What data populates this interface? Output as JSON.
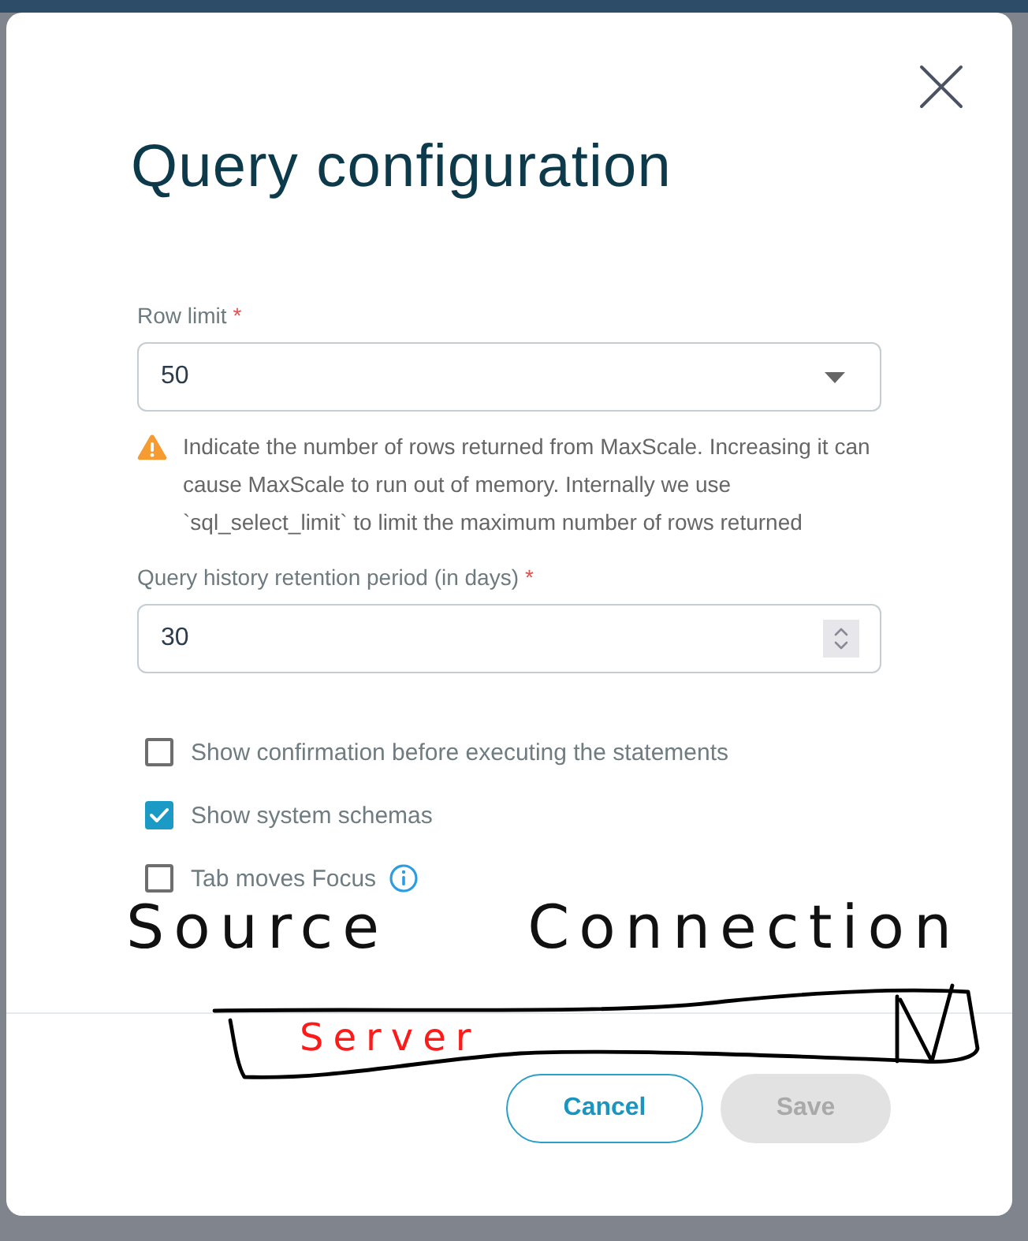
{
  "dialog": {
    "title": "Query configuration"
  },
  "row_limit": {
    "label": "Row limit",
    "required_mark": "*",
    "value": "50",
    "warning": "Indicate the number of rows returned from MaxScale. Increasing it can cause MaxScale to run out of memory. Internally we use `sql_select_limit` to limit the maximum number of rows returned"
  },
  "retention": {
    "label": "Query history retention period (in days)",
    "required_mark": "*",
    "value": "30"
  },
  "options": [
    {
      "label": "Show confirmation before executing the statements",
      "checked": false,
      "info": false
    },
    {
      "label": "Show system schemas",
      "checked": true,
      "info": false
    },
    {
      "label": "Tab moves Focus",
      "checked": false,
      "info": true
    }
  ],
  "sketch": {
    "title": "Source Connection",
    "field_value": "Server"
  },
  "buttons": [
    {
      "label": "Cancel",
      "kind": "outline",
      "disabled": false
    },
    {
      "label": "Save",
      "kind": "filled",
      "disabled": true
    }
  ]
}
